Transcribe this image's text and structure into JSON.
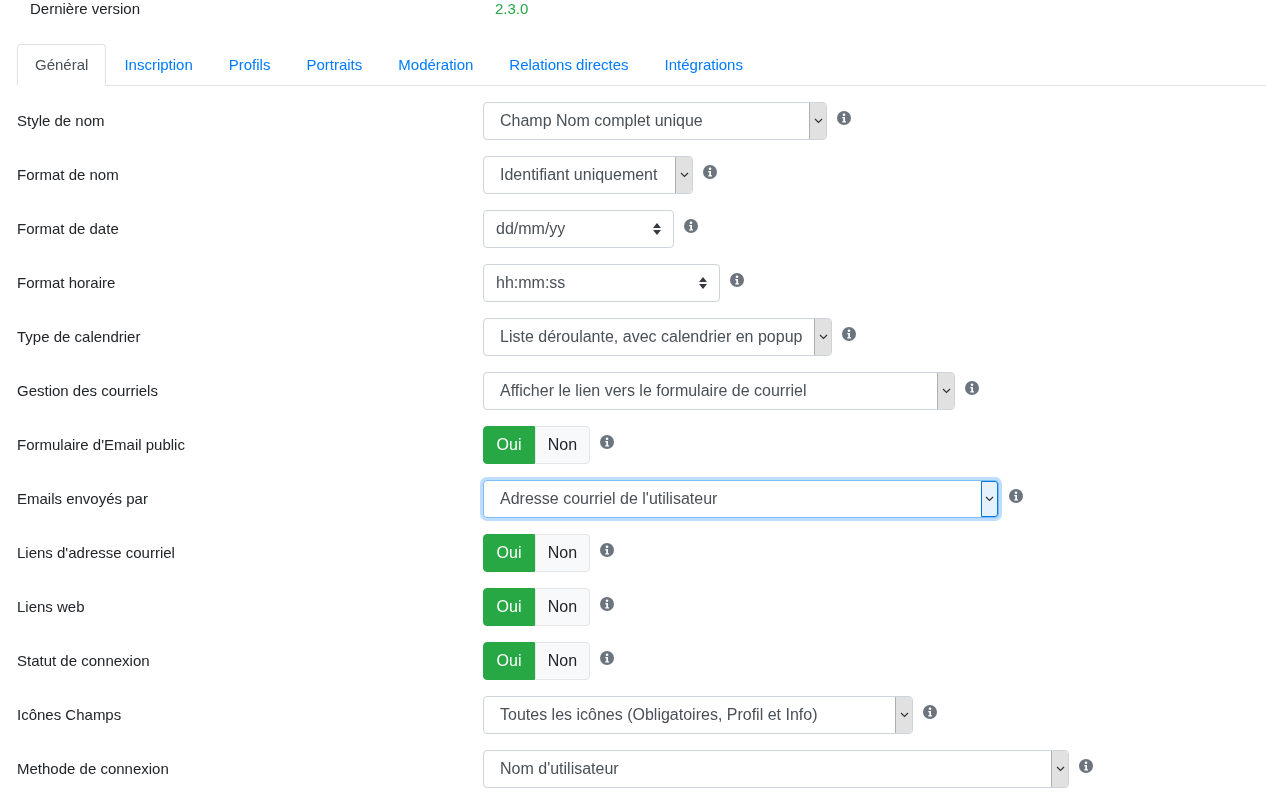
{
  "version": {
    "label": "Dernière version",
    "value": "2.3.0"
  },
  "tabs": [
    {
      "label": "Général",
      "selected": true
    },
    {
      "label": "Inscription",
      "selected": false
    },
    {
      "label": "Profils",
      "selected": false
    },
    {
      "label": "Portraits",
      "selected": false
    },
    {
      "label": "Modération",
      "selected": false
    },
    {
      "label": "Relations directes",
      "selected": false
    },
    {
      "label": "Intégrations",
      "selected": false
    }
  ],
  "fields": [
    {
      "label": "Style de nom",
      "kind": "dropdown",
      "value": "Champ Nom complet unique",
      "focused": false
    },
    {
      "label": "Format de nom",
      "kind": "dropdown",
      "value": "Identifiant uniquement",
      "focused": false
    },
    {
      "label": "Format de date",
      "kind": "spinner",
      "value": "dd/mm/yy",
      "focused": false
    },
    {
      "label": "Format horaire",
      "kind": "spinner",
      "value": "hh:mm:ss",
      "focused": false
    },
    {
      "label": "Type de calendrier",
      "kind": "dropdown",
      "value": "Liste déroulante, avec calendrier en popup",
      "focused": false
    },
    {
      "label": "Gestion des courriels",
      "kind": "dropdown",
      "value": "Afficher le lien vers le formulaire de courriel",
      "focused": false
    },
    {
      "label": "Formulaire d'Email public",
      "kind": "toggle",
      "options": [
        {
          "label": "Oui",
          "selected": true
        },
        {
          "label": "Non",
          "selected": false
        }
      ]
    },
    {
      "label": "Emails envoyés par",
      "kind": "dropdown",
      "value": "Adresse courriel de l'utilisateur",
      "focused": true
    },
    {
      "label": "Liens d'adresse courriel",
      "kind": "toggle",
      "options": [
        {
          "label": "Oui",
          "selected": true
        },
        {
          "label": "Non",
          "selected": false
        }
      ]
    },
    {
      "label": "Liens web",
      "kind": "toggle",
      "options": [
        {
          "label": "Oui",
          "selected": true
        },
        {
          "label": "Non",
          "selected": false
        }
      ]
    },
    {
      "label": "Statut de connexion",
      "kind": "toggle",
      "options": [
        {
          "label": "Oui",
          "selected": true
        },
        {
          "label": "Non",
          "selected": false
        }
      ]
    },
    {
      "label": "Icônes Champs",
      "kind": "dropdown",
      "value": "Toutes les icônes (Obligatoires, Profil et Info)",
      "focused": false
    },
    {
      "label": "Methode de connexion",
      "kind": "dropdown",
      "value": "Nom d'utilisateur",
      "focused": false
    }
  ]
}
